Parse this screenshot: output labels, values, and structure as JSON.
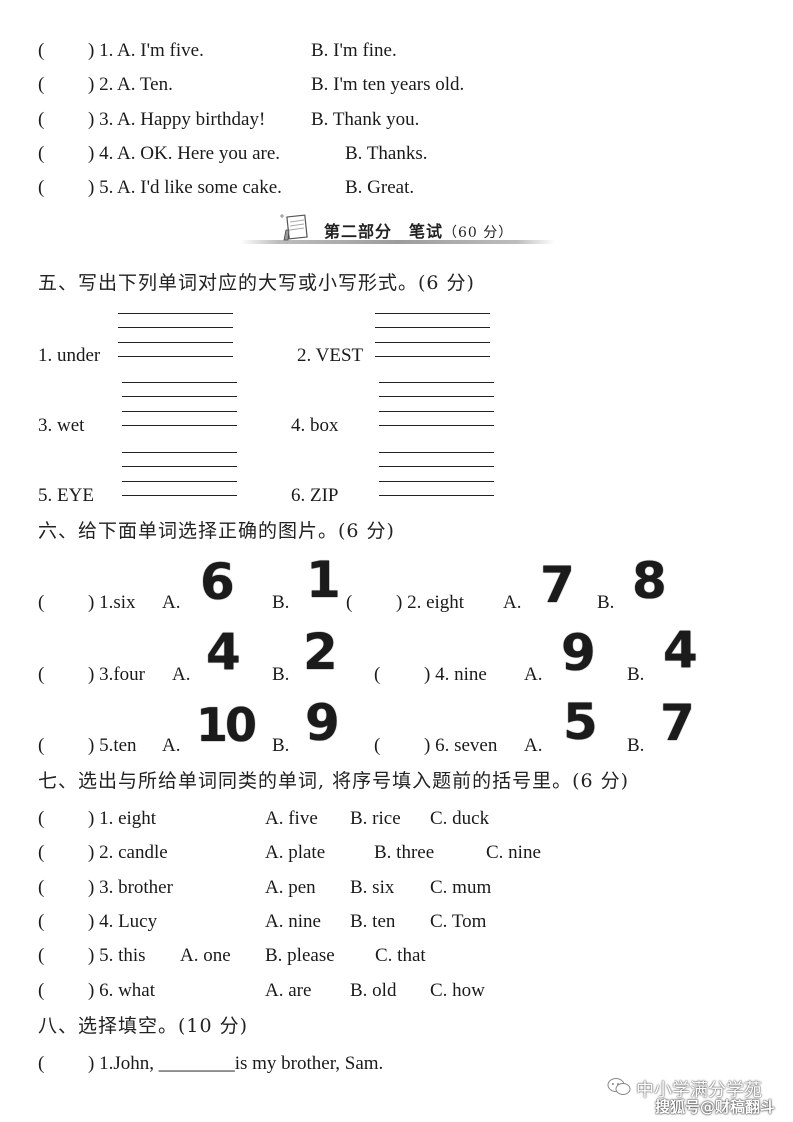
{
  "part1": {
    "items": [
      {
        "paren": "(",
        "close": ") 1. A. I'm five.",
        "b": "B. I'm fine."
      },
      {
        "paren": "(",
        "close": ") 2. A. Ten.",
        "b": "B. I'm ten years old."
      },
      {
        "paren": "(",
        "close": ") 3. A. Happy birthday!",
        "b": "B. Thank you."
      },
      {
        "paren": "(",
        "close": ") 4. A. OK. Here you are.",
        "b": "B. Thanks."
      },
      {
        "paren": "(",
        "close": ") 5. A. I'd like some cake.",
        "b": "B. Great."
      }
    ]
  },
  "banner": {
    "title": "第二部分　笔试",
    "score": "（60 分）",
    "icon": "notepad-pencil-icon"
  },
  "section5": {
    "heading": "五、写出下列单词对应的大写或小写形式。(6 分)",
    "words": [
      "1. under",
      "2. VEST",
      "3. wet",
      "4. box",
      "5. EYE",
      "6. ZIP"
    ]
  },
  "section6": {
    "heading": "六、给下面单词选择正确的图片。(6 分)",
    "items": [
      {
        "paren": "(",
        "q": ") 1.six",
        "a_label": "A.",
        "a_img": "6",
        "b_label": "B.",
        "b_img": "1"
      },
      {
        "paren": "(",
        "q": ") 2. eight",
        "a_label": "A.",
        "a_img": "7",
        "b_label": "B.",
        "b_img": "8"
      },
      {
        "paren": "(",
        "q": ") 3.four",
        "a_label": "A.",
        "a_img": "4",
        "b_label": "B.",
        "b_img": "2"
      },
      {
        "paren": "(",
        "q": ") 4. nine",
        "a_label": "A.",
        "a_img": "9",
        "b_label": "B.",
        "b_img": "4"
      },
      {
        "paren": "(",
        "q": ") 5.ten",
        "a_label": "A.",
        "a_img": "10",
        "b_label": "B.",
        "b_img": "9"
      },
      {
        "paren": "(",
        "q": ") 6. seven",
        "a_label": "A.",
        "a_img": "5",
        "b_label": "B.",
        "b_img": "7"
      }
    ]
  },
  "section7": {
    "heading": "七、选出与所给单词同类的单词, 将序号填入题前的括号里。(6 分)",
    "items": [
      {
        "paren": "(",
        "q": ") 1. eight",
        "a": "A. five",
        "b": "B. rice",
        "c": "C. duck"
      },
      {
        "paren": "(",
        "q": ") 2. candle",
        "a": "A. plate",
        "b": "B. three",
        "c": "C. nine"
      },
      {
        "paren": "(",
        "q": ") 3. brother",
        "a": "A. pen",
        "b": "B. six",
        "c": "C. mum"
      },
      {
        "paren": "(",
        "q": ") 4. Lucy",
        "a": "A. nine",
        "b": "B. ten",
        "c": "C. Tom"
      },
      {
        "paren": "(",
        "q": ") 5. this",
        "a": "A. one",
        "b": "B. please",
        "c": "C. that"
      },
      {
        "paren": "(",
        "q": ") 6. what",
        "a": "A. are",
        "b": "B. old",
        "c": "C. how"
      }
    ]
  },
  "section8": {
    "heading": "八、选择填空。(10 分)",
    "items": [
      {
        "paren": "(",
        "q": ") 1.John, ________is my brother, Sam."
      }
    ]
  },
  "watermark": {
    "line1": "中小学满分学苑",
    "line2": "搜狐号@财稿翻斗",
    "icon": "wechat-icon"
  }
}
